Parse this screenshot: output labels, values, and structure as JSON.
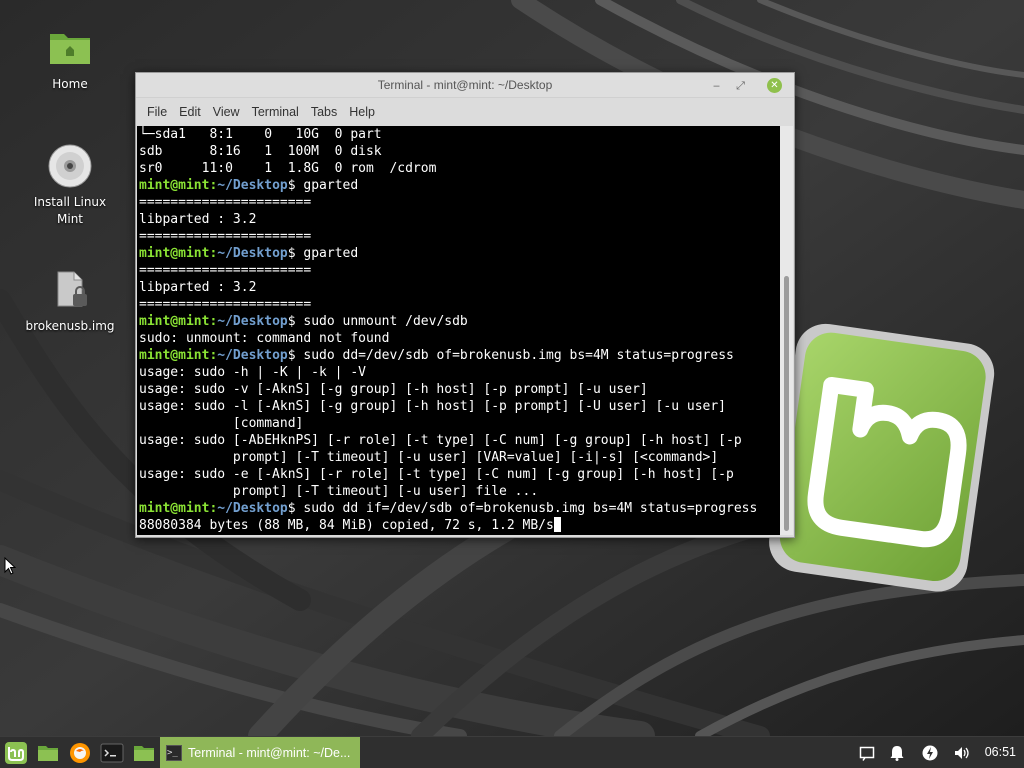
{
  "desktop": {
    "icons": [
      {
        "label": "Home",
        "icon": "folder-icon"
      },
      {
        "label": "Install Linux\nMint",
        "icon": "disc-icon"
      },
      {
        "label": "brokenusb.img",
        "icon": "locked-file-icon"
      }
    ]
  },
  "window": {
    "title": "Terminal - mint@mint: ~/Desktop",
    "menu": [
      "File",
      "Edit",
      "View",
      "Terminal",
      "Tabs",
      "Help"
    ]
  },
  "terminal": {
    "prompt_user": "mint@mint",
    "prompt_path": "~/Desktop",
    "lines": [
      {
        "type": "out",
        "text": "└─sda1   8:1    0   10G  0 part"
      },
      {
        "type": "out",
        "text": "sdb      8:16   1  100M  0 disk"
      },
      {
        "type": "out",
        "text": "sr0     11:0    1  1.8G  0 rom  /cdrom"
      },
      {
        "type": "cmd",
        "text": " gparted"
      },
      {
        "type": "out",
        "text": "======================"
      },
      {
        "type": "out",
        "text": "libparted : 3.2"
      },
      {
        "type": "out",
        "text": "======================"
      },
      {
        "type": "cmd",
        "text": " gparted"
      },
      {
        "type": "out",
        "text": "======================"
      },
      {
        "type": "out",
        "text": "libparted : 3.2"
      },
      {
        "type": "out",
        "text": "======================"
      },
      {
        "type": "cmd",
        "text": " sudo unmount /dev/sdb"
      },
      {
        "type": "out",
        "text": "sudo: unmount: command not found"
      },
      {
        "type": "cmd",
        "text": " sudo dd=/dev/sdb of=brokenusb.img bs=4M status=progress"
      },
      {
        "type": "out",
        "text": "usage: sudo -h | -K | -k | -V"
      },
      {
        "type": "out",
        "text": "usage: sudo -v [-AknS] [-g group] [-h host] [-p prompt] [-u user]"
      },
      {
        "type": "out",
        "text": "usage: sudo -l [-AknS] [-g group] [-h host] [-p prompt] [-U user] [-u user]"
      },
      {
        "type": "out",
        "text": "            [command]"
      },
      {
        "type": "out",
        "text": "usage: sudo [-AbEHknPS] [-r role] [-t type] [-C num] [-g group] [-h host] [-p"
      },
      {
        "type": "out",
        "text": "            prompt] [-T timeout] [-u user] [VAR=value] [-i|-s] [<command>]"
      },
      {
        "type": "out",
        "text": "usage: sudo -e [-AknS] [-r role] [-t type] [-C num] [-g group] [-h host] [-p"
      },
      {
        "type": "out",
        "text": "            prompt] [-T timeout] [-u user] file ..."
      },
      {
        "type": "cmd",
        "text": " sudo dd if=/dev/sdb of=brokenusb.img bs=4M status=progress"
      },
      {
        "type": "out",
        "text": "88080384 bytes (88 MB, 84 MiB) copied, 72 s, 1.2 MB/s",
        "cursor": true
      }
    ]
  },
  "taskbar": {
    "launchers": [
      {
        "name": "menu-button",
        "icon": "mint-logo-icon"
      },
      {
        "name": "show-desktop-button",
        "icon": "desktop-icon"
      },
      {
        "name": "firefox-launcher",
        "icon": "firefox-icon"
      },
      {
        "name": "terminal-launcher",
        "icon": "terminal-icon"
      },
      {
        "name": "files-launcher",
        "icon": "folder-icon"
      }
    ],
    "active_task": "Terminal - mint@mint: ~/De...",
    "tray": [
      "notification-icon",
      "bell-icon",
      "power-icon",
      "volume-icon"
    ],
    "clock": "06:51"
  },
  "colors": {
    "accent": "#8fb758",
    "prompt_user": "#8ae234",
    "prompt_path": "#729fcf"
  }
}
